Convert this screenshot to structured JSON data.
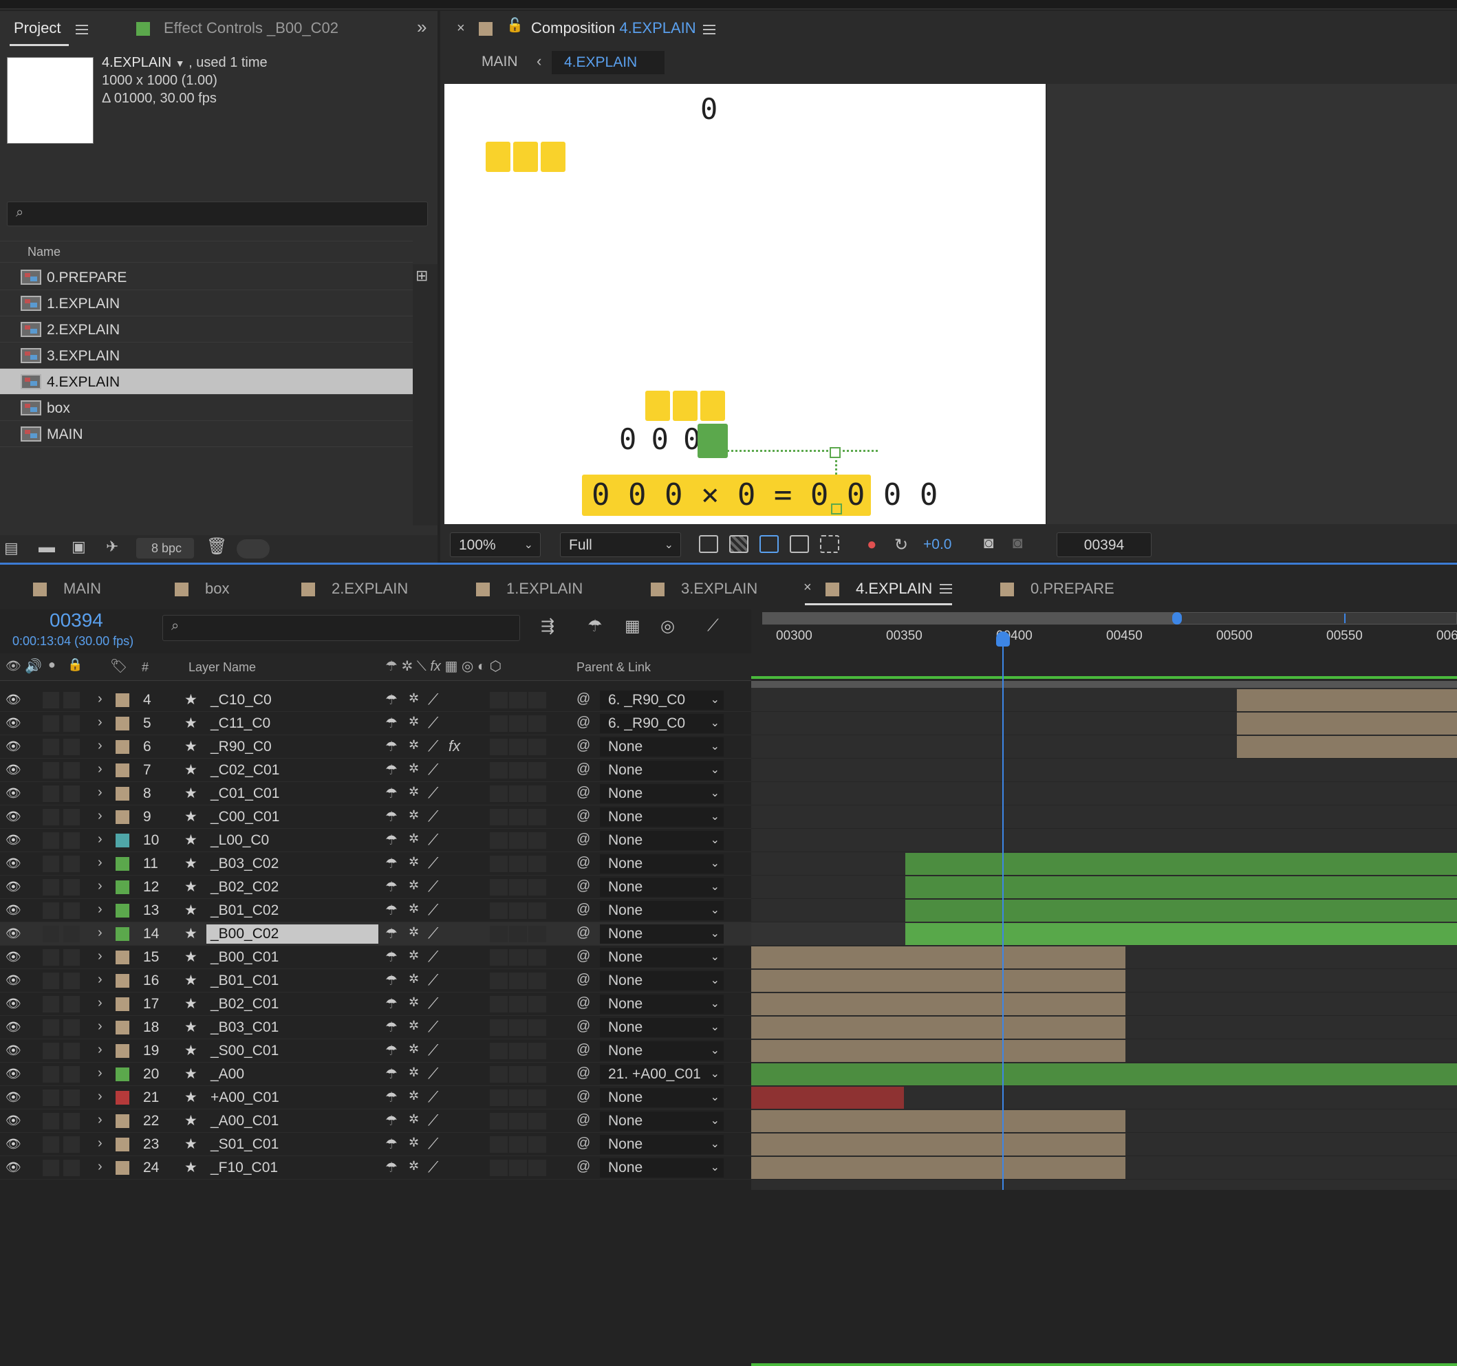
{
  "project_panel": {
    "tab_project": "Project",
    "tab_effect_controls": "Effect Controls _B00_C02",
    "selected_item": {
      "name": "4.EXPLAIN",
      "usage": ", used 1 time",
      "dimensions": "1000 x 1000 (1.00)",
      "duration": "Δ 01000, 30.00 fps"
    },
    "search_placeholder": "",
    "column_name": "Name",
    "items": [
      {
        "label": "0.PREPARE"
      },
      {
        "label": "1.EXPLAIN"
      },
      {
        "label": "2.EXPLAIN"
      },
      {
        "label": "3.EXPLAIN"
      },
      {
        "label": "4.EXPLAIN",
        "selected": true
      },
      {
        "label": "box"
      },
      {
        "label": "MAIN"
      }
    ],
    "bpc": "8 bpc"
  },
  "composition_panel": {
    "title_prefix": "Composition",
    "title_name": "4.EXPLAIN",
    "breadcrumb_parent": "MAIN",
    "breadcrumb_current": "4.EXPLAIN",
    "canvas": {
      "top_digit": "0",
      "row_digits": "0 0 0",
      "equation": "0 0 0 × 0 = 0 0 0 0",
      "colors": {
        "yellow": "#F9D22B",
        "green": "#5BA84C"
      }
    },
    "zoom": "100%",
    "resolution": "Full",
    "exposure": "+0.0",
    "current_frame": "00394"
  },
  "timeline": {
    "tabs": [
      "MAIN",
      "box",
      "2.EXPLAIN",
      "1.EXPLAIN",
      "3.EXPLAIN",
      "4.EXPLAIN",
      "0.PREPARE"
    ],
    "active_tab": "4.EXPLAIN",
    "timecode": "00394",
    "timecode_sub": "0:00:13:04 (30.00 fps)",
    "col_num": "#",
    "col_layer_name": "Layer Name",
    "col_parent": "Parent & Link",
    "ruler_ticks": [
      "00300",
      "00350",
      "00400",
      "00450",
      "00500",
      "00550",
      "006"
    ],
    "layers": [
      {
        "num": "4",
        "name": "_C10_C0",
        "label_color": "#B39C7E",
        "parent": "6. _R90_C0"
      },
      {
        "num": "5",
        "name": "_C11_C0",
        "label_color": "#B39C7E",
        "parent": "6. _R90_C0"
      },
      {
        "num": "6",
        "name": "_R90_C0",
        "label_color": "#B39C7E",
        "parent": "None",
        "fx": "fx"
      },
      {
        "num": "7",
        "name": "_C02_C01",
        "label_color": "#B39C7E",
        "parent": "None"
      },
      {
        "num": "8",
        "name": "_C01_C01",
        "label_color": "#B39C7E",
        "parent": "None"
      },
      {
        "num": "9",
        "name": "_C00_C01",
        "label_color": "#B39C7E",
        "parent": "None"
      },
      {
        "num": "10",
        "name": "_L00_C0",
        "label_color": "#4FA6A8",
        "parent": "None"
      },
      {
        "num": "11",
        "name": "_B03_C02",
        "label_color": "#5BA84C",
        "parent": "None"
      },
      {
        "num": "12",
        "name": "_B02_C02",
        "label_color": "#5BA84C",
        "parent": "None"
      },
      {
        "num": "13",
        "name": "_B01_C02",
        "label_color": "#5BA84C",
        "parent": "None"
      },
      {
        "num": "14",
        "name": "_B00_C02",
        "label_color": "#5BA84C",
        "parent": "None",
        "selected": true
      },
      {
        "num": "15",
        "name": "_B00_C01",
        "label_color": "#B39C7E",
        "parent": "None"
      },
      {
        "num": "16",
        "name": "_B01_C01",
        "label_color": "#B39C7E",
        "parent": "None"
      },
      {
        "num": "17",
        "name": "_B02_C01",
        "label_color": "#B39C7E",
        "parent": "None"
      },
      {
        "num": "18",
        "name": "_B03_C01",
        "label_color": "#B39C7E",
        "parent": "None"
      },
      {
        "num": "19",
        "name": "_S00_C01",
        "label_color": "#B39C7E",
        "parent": "None"
      },
      {
        "num": "20",
        "name": "_A00",
        "label_color": "#5BA84C",
        "parent": "21. +A00_C01"
      },
      {
        "num": "21",
        "name": "+A00_C01",
        "label_color": "#B53A3A",
        "parent": "None"
      },
      {
        "num": "22",
        "name": "_A00_C01",
        "label_color": "#B39C7E",
        "parent": "None"
      },
      {
        "num": "23",
        "name": "_S01_C01",
        "label_color": "#B39C7E",
        "parent": "None"
      },
      {
        "num": "24",
        "name": "_F10_C01",
        "label_color": "#B39C7E",
        "parent": "None"
      }
    ]
  }
}
